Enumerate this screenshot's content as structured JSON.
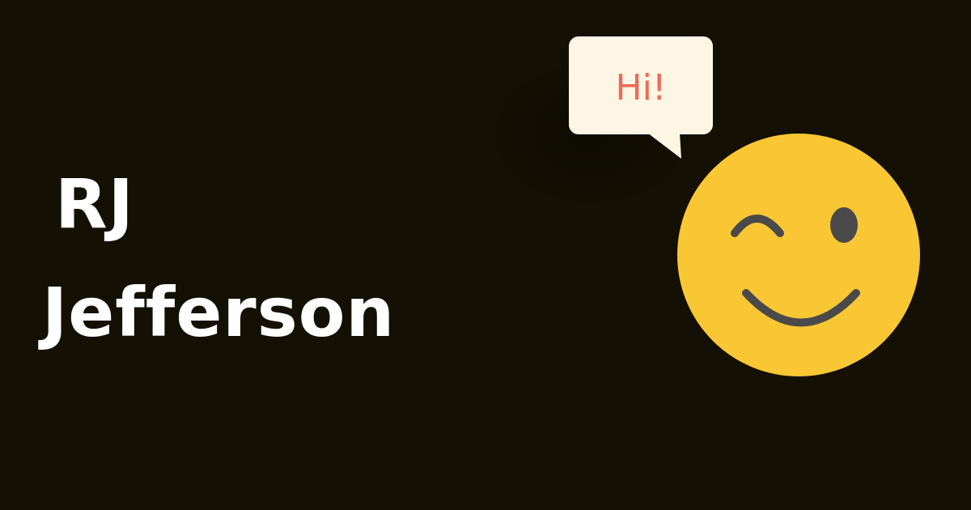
{
  "card": {
    "background_color": "#141003",
    "name_color": "#ffffff",
    "name_line_1": "RJ",
    "name_line_2": "Jefferson"
  },
  "speech_bubble": {
    "text": "Hi!",
    "fill_color": "#fdf6e4",
    "text_color": "#ec6b57"
  },
  "emoji": {
    "icon": "winking-smiley-face-icon",
    "face_color": "#fac734",
    "feature_color": "#4a4a4a"
  }
}
